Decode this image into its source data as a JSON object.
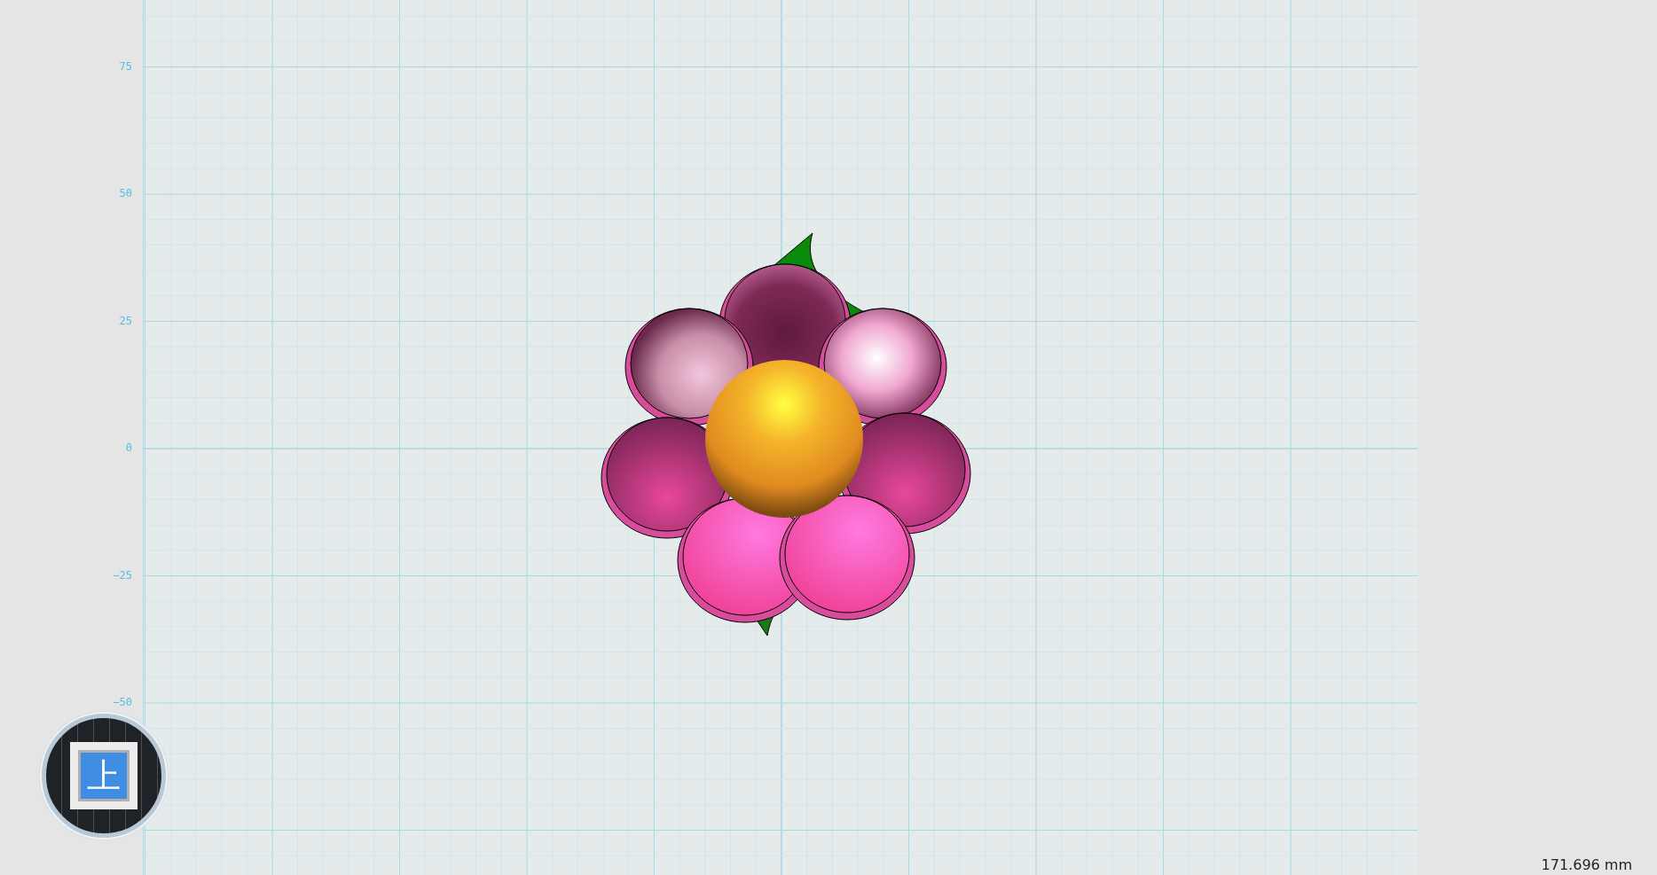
{
  "axis_labels": [
    "75",
    "50",
    "25",
    "0",
    "−25",
    "−50"
  ],
  "view_cube": {
    "face_label": "上"
  },
  "scale_readout": "171.696 mm"
}
